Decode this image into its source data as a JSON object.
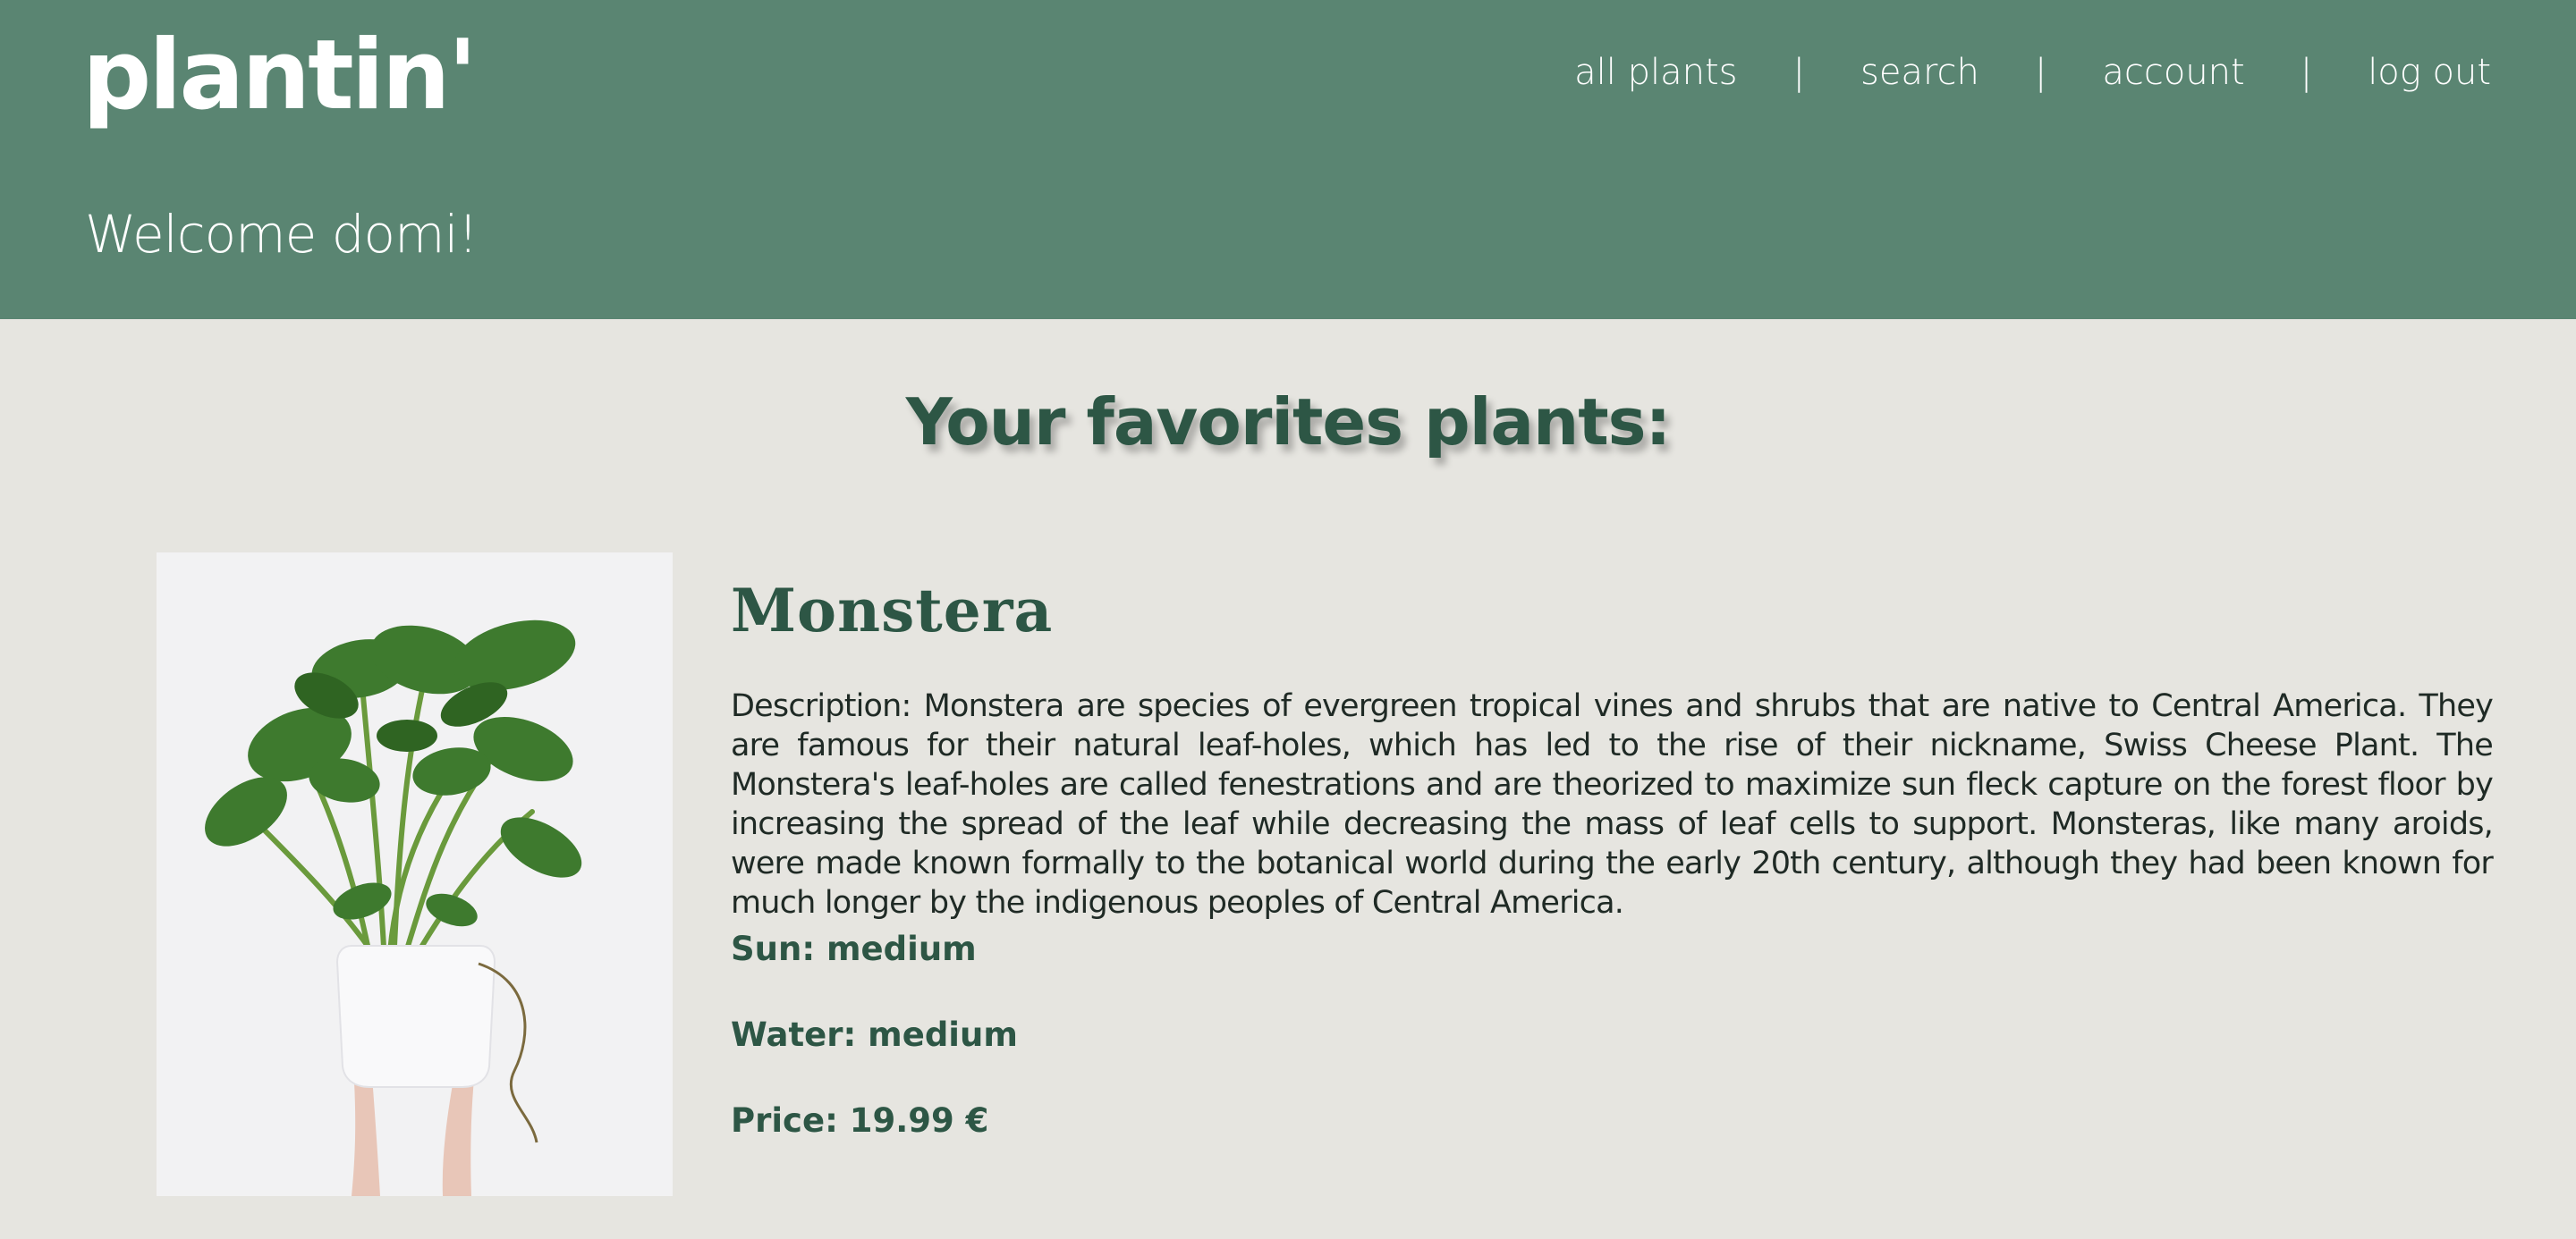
{
  "header": {
    "logo": "plantin'",
    "nav": {
      "all_plants": "all plants",
      "search": "search",
      "account": "account",
      "log_out": "log out",
      "separator": "|"
    },
    "welcome": "Welcome domi!"
  },
  "main": {
    "title": "Your favorites plants:",
    "favorites": [
      {
        "name": "Monstera",
        "description": "Description: Monstera are species of evergreen tropical vines and shrubs that are native to Central America. They are famous for their natural leaf-holes, which has led to the rise of their nickname, Swiss Cheese Plant. The Monstera's leaf-holes are called fenestrations and are theorized to maximize sun fleck capture on the forest floor by increasing the spread of the leaf while decreasing the mass of leaf cells to support. Monsteras, like many aroids, were made known formally to the botanical world during the early 20th century, although they had been known for much longer by the indigenous peoples of Central America.",
        "sun": "Sun: medium",
        "water": "Water: medium",
        "price": "Price: 19.99 €"
      }
    ]
  },
  "colors": {
    "header_bg": "#5a8572",
    "page_bg": "#e6e5e0",
    "accent_dark_green": "#2d5645"
  }
}
